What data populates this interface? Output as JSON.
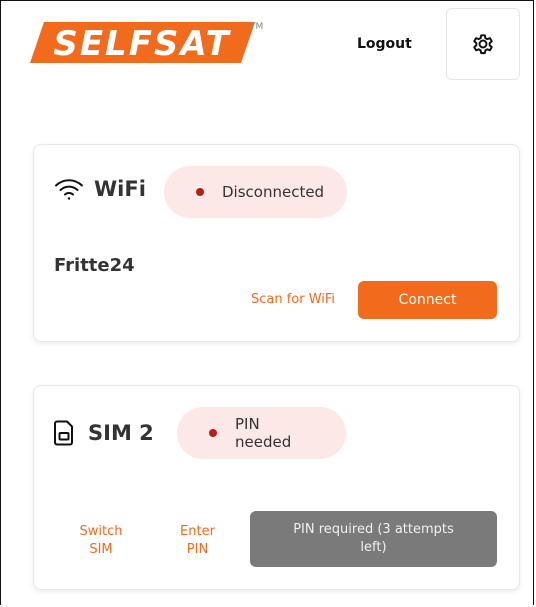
{
  "header": {
    "brand": "SELFSAT",
    "trademark": "TM",
    "logout_label": "Logout",
    "settings_icon": "gear-icon"
  },
  "colors": {
    "accent": "#f26a1b",
    "status_bg": "#fde8e8",
    "status_dot": "#b91c1c",
    "disabled_bg": "#7a7a7a"
  },
  "wifi": {
    "icon": "wifi-icon",
    "title": "WiFi",
    "status": "Disconnected",
    "network_name": "Fritte24",
    "scan_label": "Scan for WiFi",
    "connect_label": "Connect"
  },
  "sim": {
    "icon": "sim-card-icon",
    "title": "SIM 2",
    "status": "PIN needed",
    "switch_label": "Switch SIM",
    "enter_pin_label": "Enter PIN",
    "pin_required_label": "PIN required (3 attempts left)"
  }
}
